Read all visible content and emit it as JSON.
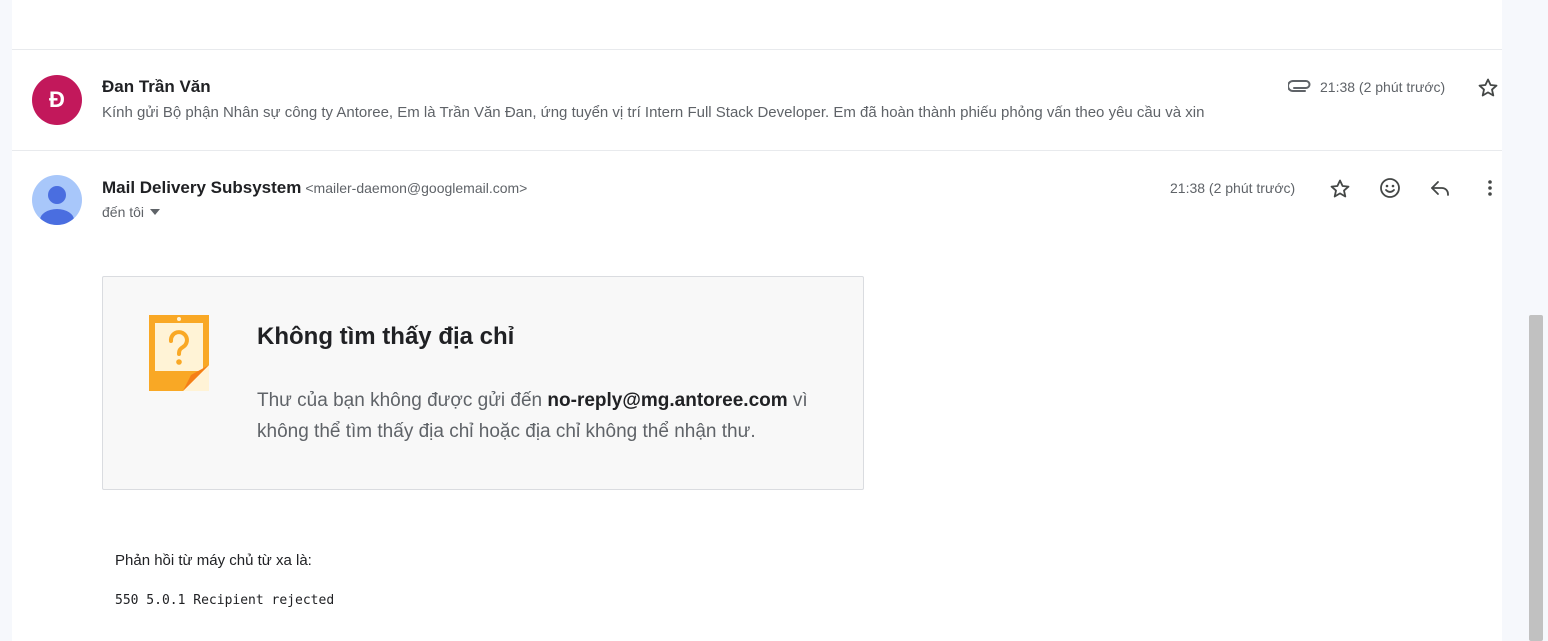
{
  "collapsed_message": {
    "avatar_letter": "Đ",
    "avatar_color": "#c2185b",
    "sender": "Đan Trần Văn",
    "snippet": "Kính gửi Bộ phận Nhân sự công ty Antoree, Em là Trần Văn Đan, ứng tuyển vị trí Intern Full Stack Developer. Em đã hoàn thành phiếu phỏng vấn theo yêu cầu và xin",
    "time": "21:38 (2 phút trước)",
    "attachment_icon": "paperclip-icon",
    "star_icon": "star-icon"
  },
  "expanded_message": {
    "sender_name": "Mail Delivery Subsystem",
    "sender_email": "<mailer-daemon@googlemail.com>",
    "to_label": "đến tôi",
    "time": "21:38 (2 phút trước)",
    "actions": [
      "star-icon",
      "emoji-icon",
      "reply-icon",
      "more-vert-icon"
    ]
  },
  "bounce_card": {
    "title": "Không tìm thấy địa chỉ",
    "body_prefix": "Thư của bạn không được gửi đến ",
    "recipient": "no-reply@mg.antoree.com",
    "body_suffix": " vì không thể tìm thấy địa chỉ hoặc địa chỉ không thể nhận thư.",
    "icon_color": "#f9a825"
  },
  "server_reply": {
    "label": "Phản hồi từ máy chủ từ xa là:",
    "code": "550 5.0.1 Recipient rejected"
  }
}
